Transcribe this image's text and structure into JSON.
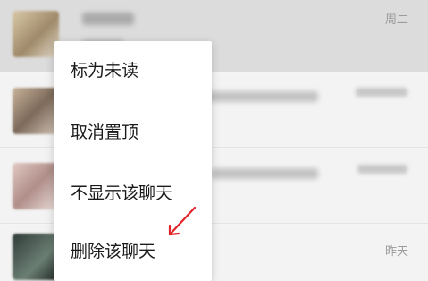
{
  "chat_list": {
    "rows": [
      {
        "time": "周二"
      },
      {
        "time": ""
      },
      {
        "time": ""
      },
      {
        "time": "昨天"
      }
    ]
  },
  "context_menu": {
    "items": [
      {
        "label": "标为未读"
      },
      {
        "label": "取消置顶"
      },
      {
        "label": "不显示该聊天"
      },
      {
        "label": "删除该聊天"
      }
    ]
  },
  "colors": {
    "menu_background": "#ffffff",
    "pinned_row_background": "#dcdcdc",
    "list_background": "#f3f3f3",
    "arrow": "#e2252b"
  },
  "icons": {
    "annotation": "red-arrow-icon"
  }
}
